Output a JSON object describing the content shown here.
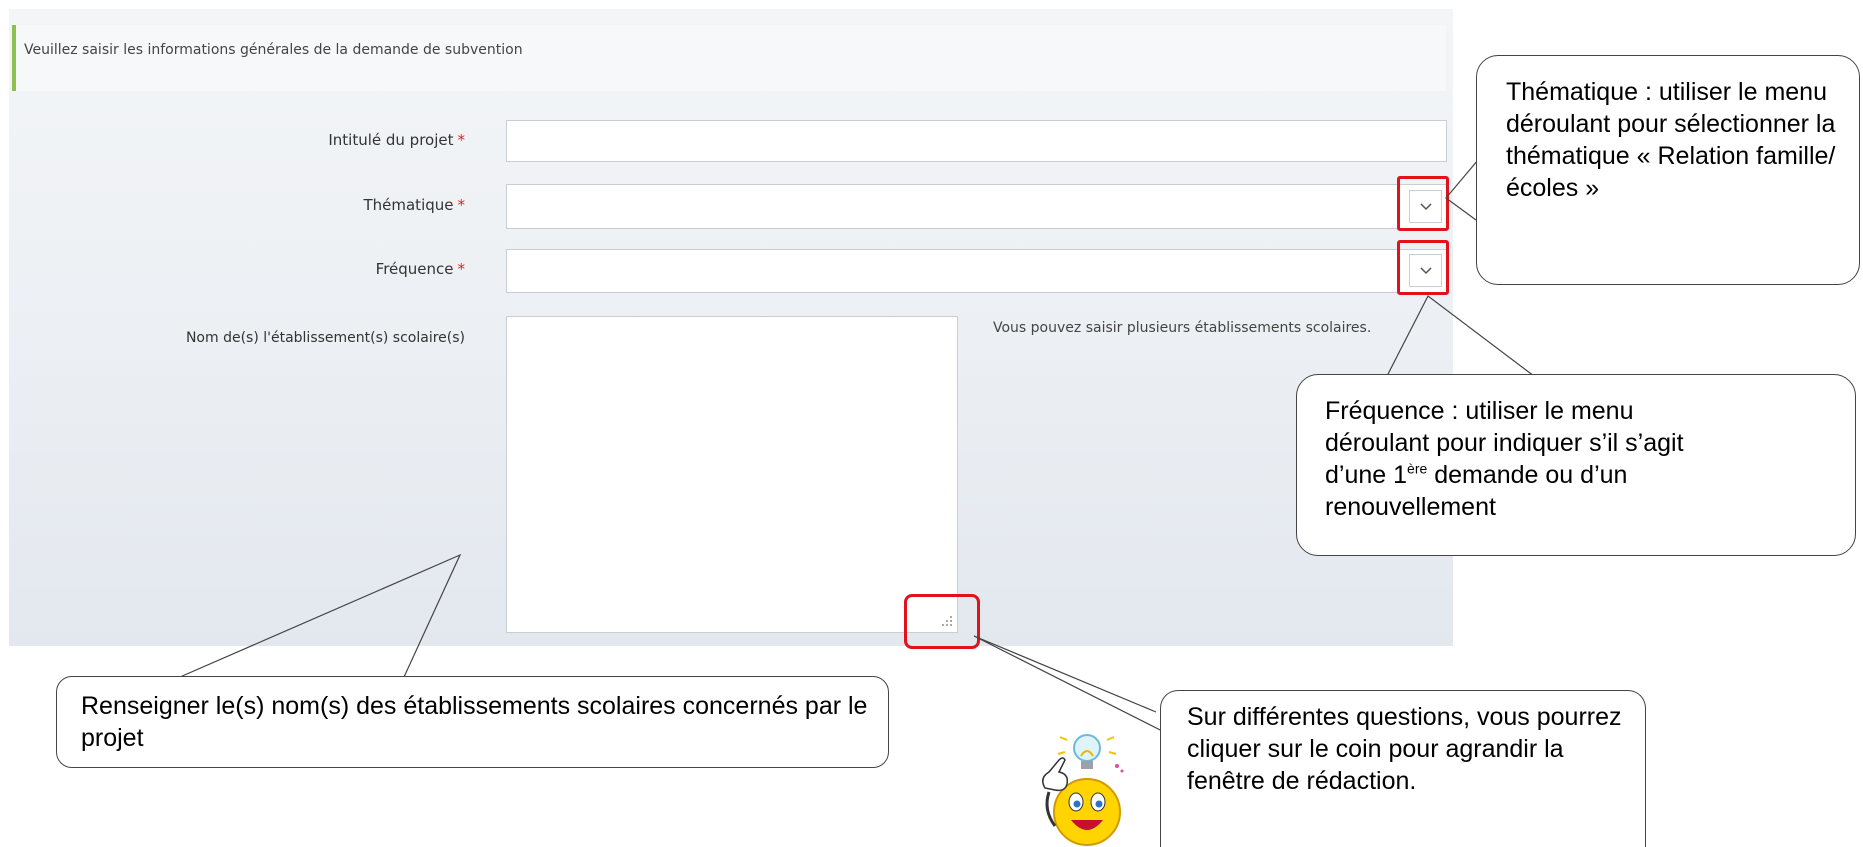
{
  "form": {
    "info_text": "Veuillez saisir les informations générales de la demande de subvention",
    "required_marker": "*",
    "fields": {
      "intitule": {
        "label": "Intitulé du projet",
        "value": ""
      },
      "thematique": {
        "label": "Thématique",
        "value": ""
      },
      "frequence": {
        "label": "Fréquence",
        "value": ""
      },
      "etablissements": {
        "label": "Nom de(s) l'établissement(s) scolaire(s)",
        "value": ""
      }
    },
    "help_text": "Vous pouvez saisir plusieurs établissements scolaires."
  },
  "callouts": {
    "thematique": "Thématique : utiliser le menu déroulant pour sélectionner la thématique « Relation famille/écoles »",
    "frequence": {
      "line1": "Fréquence : utiliser le menu",
      "line2": "déroulant pour indiquer s’il s’agit",
      "line3_prefix": "d’une 1",
      "line3_sup": "ère",
      "line3_suffix": " demande ou d’un",
      "line4": "renouvellement"
    },
    "etablissements": "Renseigner le(s) nom(s) des établissements scolaires concernés par le projet",
    "resize": "Sur différentes questions, vous pourrez cliquer sur le coin pour agrandir la fenêtre de rédaction."
  },
  "icons": {
    "select_arrow": "chevron-down-icon",
    "resize_grip": "resize-grip-icon",
    "mascot": "idea-smiley-icon"
  },
  "colors": {
    "accent_green": "#8cc152",
    "required_red": "#d9262a",
    "highlight_red": "#e0121a"
  }
}
